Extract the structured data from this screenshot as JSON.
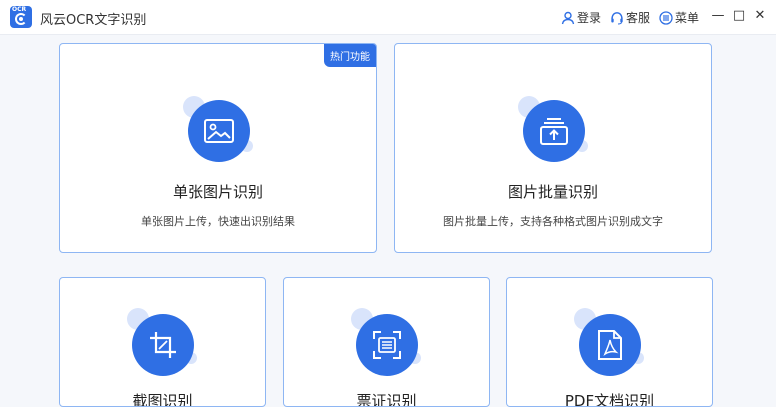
{
  "app": {
    "title": "风云OCR文字识别",
    "logo_text": "OCR"
  },
  "topnav": {
    "login": "登录",
    "service": "客服",
    "menu": "菜单"
  },
  "window_controls": {
    "minimize": "—",
    "maximize": "□",
    "close": "✕"
  },
  "cards": {
    "single": {
      "title": "单张图片识别",
      "desc": "单张图片上传，快速出识别结果",
      "badge": "热门功能",
      "icon": "image-icon"
    },
    "batch": {
      "title": "图片批量识别",
      "desc": "图片批量上传，支持各种格式图片识别成文字",
      "icon": "upload-stack-icon"
    },
    "crop": {
      "title": "截图识别",
      "icon": "crop-icon"
    },
    "table": {
      "title": "票证识别",
      "icon": "scan-document-icon"
    },
    "pdf": {
      "title": "PDF文档识别",
      "icon": "pdf-icon"
    }
  },
  "colors": {
    "accent": "#2f6fe4",
    "card_border": "#8eb6f3",
    "decor": "#d9e4fb",
    "background": "#f5f7fb"
  }
}
